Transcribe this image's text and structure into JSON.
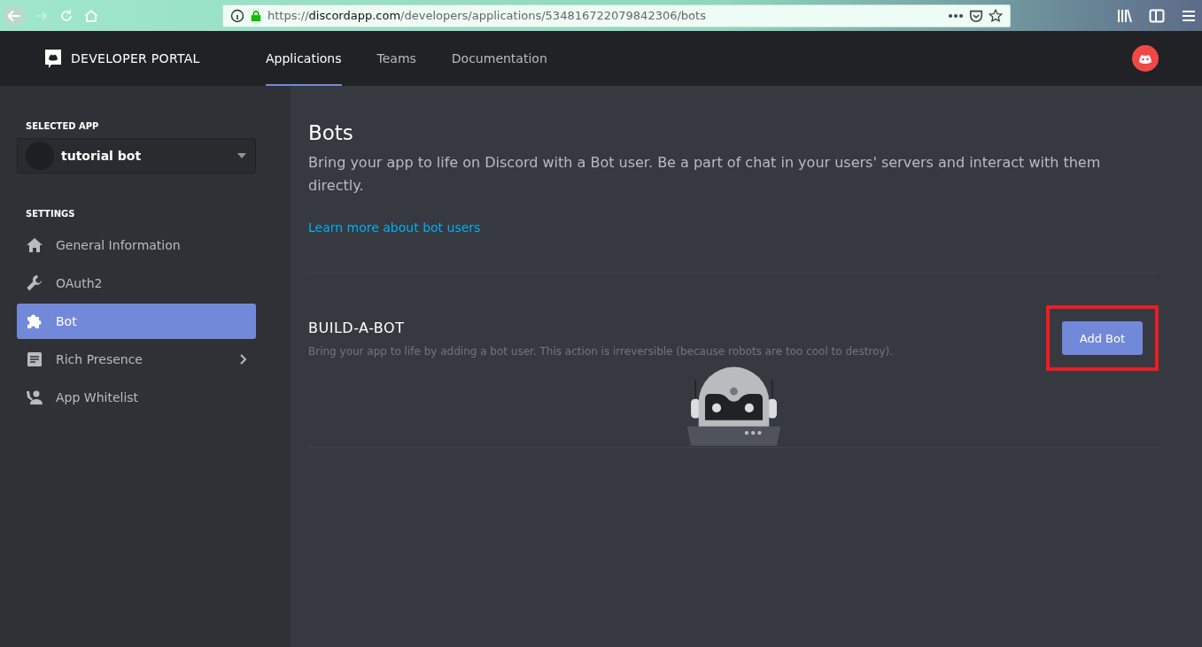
{
  "browser": {
    "url_scheme": "https://",
    "url_host": "discordapp.com",
    "url_path": "/developers/applications/534816722079842306/bots"
  },
  "header": {
    "brand": "DEVELOPER PORTAL",
    "tabs": [
      {
        "label": "Applications",
        "selected": true
      },
      {
        "label": "Teams",
        "selected": false
      },
      {
        "label": "Documentation",
        "selected": false
      }
    ]
  },
  "sidebar": {
    "selected_app_label": "SELECTED APP",
    "app_name": "tutorial bot",
    "settings_label": "SETTINGS",
    "items": [
      {
        "label": "General Information",
        "kind": "home",
        "selected": false,
        "submenu": false
      },
      {
        "label": "OAuth2",
        "kind": "wrench",
        "selected": false,
        "submenu": false
      },
      {
        "label": "Bot",
        "kind": "puzzle",
        "selected": true,
        "submenu": false
      },
      {
        "label": "Rich Presence",
        "kind": "document",
        "selected": false,
        "submenu": true
      },
      {
        "label": "App Whitelist",
        "kind": "person",
        "selected": false,
        "submenu": false
      }
    ]
  },
  "content": {
    "title": "Bots",
    "description": "Bring your app to life on Discord with a Bot user. Be a part of chat in your users' servers and interact with them directly.",
    "link": "Learn more about bot users",
    "section_title": "BUILD-A-BOT",
    "section_description": "Bring your app to life by adding a bot user. This action is irreversible (because robots are too cool to destroy).",
    "button": "Add Bot",
    "button_highlighted": true
  }
}
